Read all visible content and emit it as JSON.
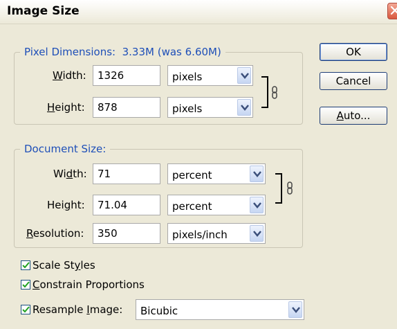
{
  "window": {
    "title": "Image Size"
  },
  "pixel_dimensions": {
    "legend_label": "Pixel Dimensions:",
    "legend_value": "3.33M (was 6.60M)",
    "width": {
      "label_pre": "",
      "label_key": "W",
      "label_post": "idth:",
      "value": "1326",
      "unit": "pixels"
    },
    "height": {
      "label_pre": "",
      "label_key": "H",
      "label_post": "eight:",
      "value": "878",
      "unit": "pixels"
    }
  },
  "document_size": {
    "legend": "Document Size:",
    "width": {
      "label_pre": "Wi",
      "label_key": "d",
      "label_post": "th:",
      "value": "71",
      "unit": "percent"
    },
    "height": {
      "label_pre": "Hei",
      "label_key": "g",
      "label_post": "ht:",
      "value": "71.04",
      "unit": "percent"
    },
    "resolution": {
      "label_pre": "",
      "label_key": "R",
      "label_post": "esolution:",
      "value": "350",
      "unit": "pixels/inch"
    }
  },
  "buttons": {
    "ok": "OK",
    "cancel": "Cancel",
    "auto_key": "A",
    "auto_rest": "uto..."
  },
  "options": {
    "scale_styles": {
      "label_pre": "Scale St",
      "label_key": "y",
      "label_post": "les",
      "checked": true
    },
    "constrain": {
      "label_pre": "",
      "label_key": "C",
      "label_post": "onstrain Proportions",
      "checked": true
    },
    "resample": {
      "label_pre": "Resample ",
      "label_key": "I",
      "label_post": "mage:",
      "checked": true,
      "method": "Bicubic"
    }
  },
  "icons": {
    "close": "close-icon",
    "dropdown": "chevron-down-icon",
    "link": "chain-link-icon",
    "check": "check-icon"
  },
  "colors": {
    "dialog_bg": "#ece9d8",
    "legend_text": "#1e4fb8",
    "close_button": "#d9583f",
    "checkmark": "#21a121"
  }
}
